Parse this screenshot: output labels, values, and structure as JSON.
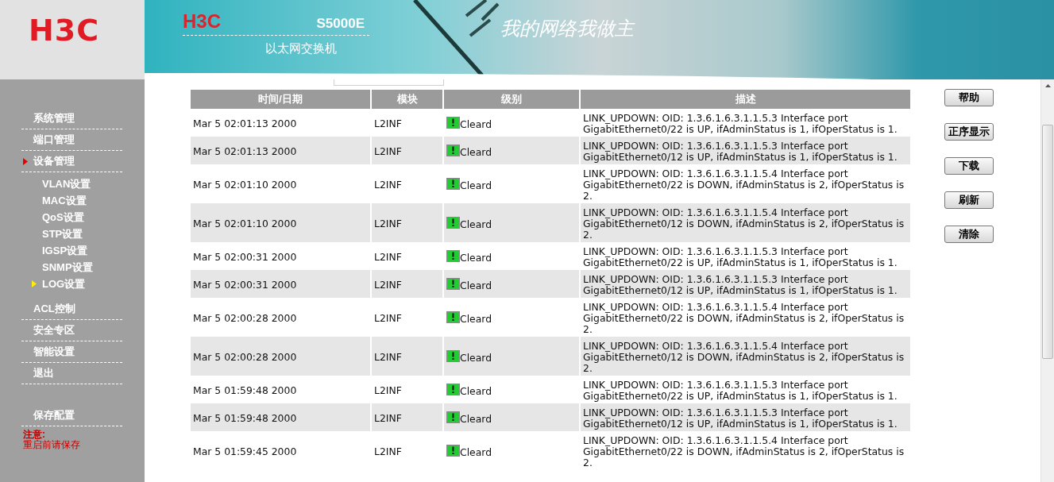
{
  "logo": {
    "text": "H3C"
  },
  "banner": {
    "brand": "H3C",
    "model": "S5000E",
    "subtitle": "以太网交换机",
    "slogan": "我的网络我做主"
  },
  "sidebar": {
    "items": [
      {
        "label": "系统管理",
        "expanded": false
      },
      {
        "label": "端口管理",
        "expanded": false
      },
      {
        "label": "设备管理",
        "expanded": true,
        "children": [
          {
            "label": "VLAN设置",
            "selected": false
          },
          {
            "label": "MAC设置",
            "selected": false
          },
          {
            "label": "QoS设置",
            "selected": false
          },
          {
            "label": "STP设置",
            "selected": false
          },
          {
            "label": "IGSP设置",
            "selected": false
          },
          {
            "label": "SNMP设置",
            "selected": false
          },
          {
            "label": "LOG设置",
            "selected": true
          }
        ]
      },
      {
        "label": "ACL控制",
        "expanded": false
      },
      {
        "label": "安全专区",
        "expanded": false
      },
      {
        "label": "智能设置",
        "expanded": false
      },
      {
        "label": "退出",
        "expanded": false
      }
    ],
    "save": "保存配置",
    "note_title": "注意:",
    "note": "重启前请保存"
  },
  "table": {
    "columns": [
      "时间/日期",
      "模块",
      "级别",
      "描述"
    ],
    "rows": [
      {
        "time": "Mar 5 02:01:13 2000",
        "module": "L2INF",
        "level": "Cleard",
        "description": "LINK_UPDOWN: OID: 1.3.6.1.6.3.1.1.5.3 Interface port GigabitEthernet0/22 is UP, ifAdminStatus is 1, ifOperStatus is 1."
      },
      {
        "time": "Mar 5 02:01:13 2000",
        "module": "L2INF",
        "level": "Cleard",
        "description": "LINK_UPDOWN: OID: 1.3.6.1.6.3.1.1.5.3 Interface port GigabitEthernet0/12 is UP, ifAdminStatus is 1, ifOperStatus is 1."
      },
      {
        "time": "Mar 5 02:01:10 2000",
        "module": "L2INF",
        "level": "Cleard",
        "description": "LINK_UPDOWN: OID: 1.3.6.1.6.3.1.1.5.4 Interface port GigabitEthernet0/22 is DOWN, ifAdminStatus is 2, ifOperStatus is 2."
      },
      {
        "time": "Mar 5 02:01:10 2000",
        "module": "L2INF",
        "level": "Cleard",
        "description": "LINK_UPDOWN: OID: 1.3.6.1.6.3.1.1.5.4 Interface port GigabitEthernet0/12 is DOWN, ifAdminStatus is 2, ifOperStatus is 2."
      },
      {
        "time": "Mar 5 02:00:31 2000",
        "module": "L2INF",
        "level": "Cleard",
        "description": "LINK_UPDOWN: OID: 1.3.6.1.6.3.1.1.5.3 Interface port GigabitEthernet0/22 is UP, ifAdminStatus is 1, ifOperStatus is 1."
      },
      {
        "time": "Mar 5 02:00:31 2000",
        "module": "L2INF",
        "level": "Cleard",
        "description": "LINK_UPDOWN: OID: 1.3.6.1.6.3.1.1.5.3 Interface port GigabitEthernet0/12 is UP, ifAdminStatus is 1, ifOperStatus is 1."
      },
      {
        "time": "Mar 5 02:00:28 2000",
        "module": "L2INF",
        "level": "Cleard",
        "description": "LINK_UPDOWN: OID: 1.3.6.1.6.3.1.1.5.4 Interface port GigabitEthernet0/22 is DOWN, ifAdminStatus is 2, ifOperStatus is 2."
      },
      {
        "time": "Mar 5 02:00:28 2000",
        "module": "L2INF",
        "level": "Cleard",
        "description": "LINK_UPDOWN: OID: 1.3.6.1.6.3.1.1.5.4 Interface port GigabitEthernet0/12 is DOWN, ifAdminStatus is 2, ifOperStatus is 2."
      },
      {
        "time": "Mar 5 01:59:48 2000",
        "module": "L2INF",
        "level": "Cleard",
        "description": "LINK_UPDOWN: OID: 1.3.6.1.6.3.1.1.5.3 Interface port GigabitEthernet0/22 is UP, ifAdminStatus is 1, ifOperStatus is 1."
      },
      {
        "time": "Mar 5 01:59:48 2000",
        "module": "L2INF",
        "level": "Cleard",
        "description": "LINK_UPDOWN: OID: 1.3.6.1.6.3.1.1.5.3 Interface port GigabitEthernet0/12 is UP, ifAdminStatus is 1, ifOperStatus is 1."
      },
      {
        "time": "Mar 5 01:59:45 2000",
        "module": "L2INF",
        "level": "Cleard",
        "description": "LINK_UPDOWN: OID: 1.3.6.1.6.3.1.1.5.4 Interface port GigabitEthernet0/22 is DOWN, ifAdminStatus is 2, ifOperStatus is 2."
      }
    ]
  },
  "buttons": [
    "帮助",
    "正序显示",
    "下载",
    "刷新",
    "清除"
  ]
}
